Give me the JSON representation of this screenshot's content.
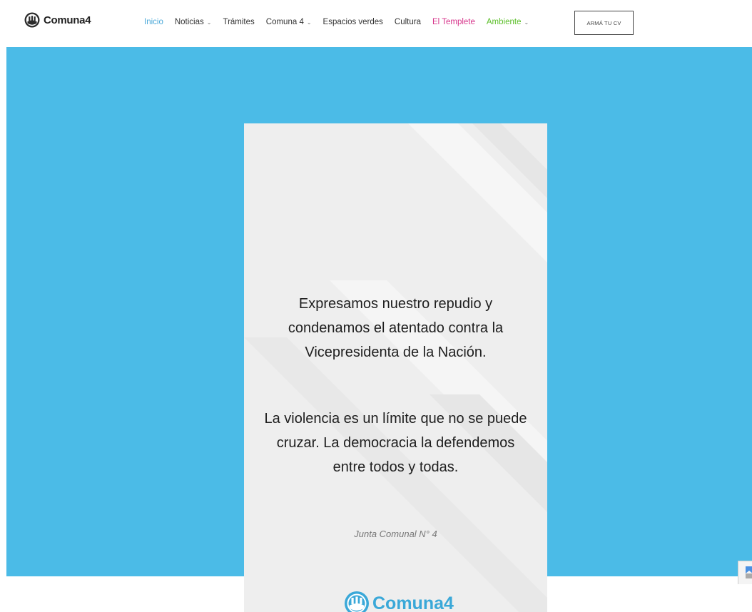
{
  "header": {
    "logo_text": "Comuna4",
    "nav": [
      {
        "label": "Inicio",
        "color": "#4aa8d8",
        "has_dropdown": false
      },
      {
        "label": "Noticias",
        "color": "#333333",
        "has_dropdown": true
      },
      {
        "label": "Trámites",
        "color": "#333333",
        "has_dropdown": false
      },
      {
        "label": "Comuna 4",
        "color": "#333333",
        "has_dropdown": true
      },
      {
        "label": "Espacios verdes",
        "color": "#333333",
        "has_dropdown": false
      },
      {
        "label": "Cultura",
        "color": "#333333",
        "has_dropdown": false
      },
      {
        "label": "El Templete",
        "color": "#d6338a",
        "has_dropdown": false
      },
      {
        "label": "Ambiente",
        "color": "#5cbf2a",
        "has_dropdown": true
      }
    ],
    "cta_label": "ARMÁ TU CV"
  },
  "hero": {
    "background_color": "#4bbbe7",
    "card": {
      "statement_1": [
        "Expresamos nuestro repudio y",
        "condenamos el atentado contra la",
        "Vicepresidenta de la Nación."
      ],
      "statement_2": [
        "La violencia es un límite que no se puede",
        "cruzar. La democracia la defendemos",
        "entre todos y todas."
      ],
      "signature": "Junta Comunal N° 4",
      "logo_text_main": "Comuna",
      "logo_text_number": "4",
      "brand_color": "#3aa8d8"
    }
  },
  "icons": {
    "logo": "comuna-emblem-icon",
    "dropdown": "chevron-down-icon",
    "recaptcha": "recaptcha-icon"
  }
}
